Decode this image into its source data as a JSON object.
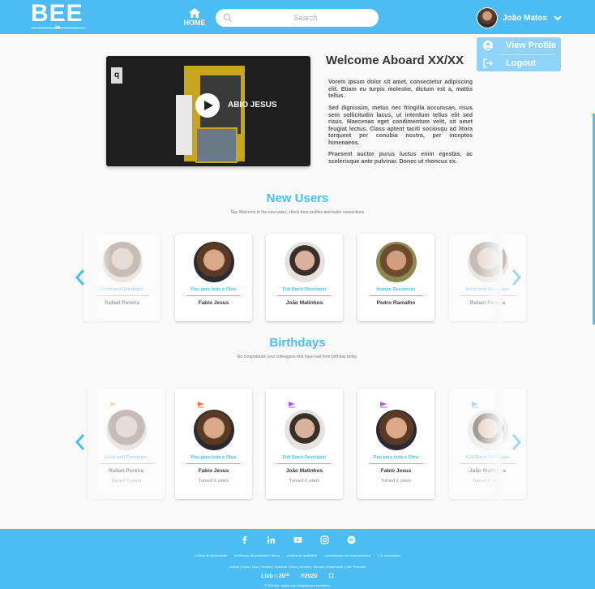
{
  "header": {
    "logo": "BEE",
    "logo_sub": "in",
    "home_label": "HOME",
    "search_placeholder": "Search",
    "user_name": "João Matos"
  },
  "dropdown": {
    "view_profile": "View Profile",
    "logout": "Logout"
  },
  "welcome": {
    "title": "Welcome Aboard XX/XX",
    "video_title": "ABIO JESUS",
    "video_badge": "q",
    "paragraphs": [
      "Vorem ipsum dolor sit amet, consectetur adipiscing elit. Etiam eu turpis molestie, dictum est a, mattis tellus.",
      "Sed dignissim, metus nec fringilla accumsan, risus sem sollicitudin lacus, ut interdum tellus elit sed risus. Maecenas eget condimentum velit, sit amet feugiat lectus. Class aptent taciti sociosqu ad litora torquent per conubia nostra, per inceptos himenaeos.",
      "Praesent auctor purus luctus enim egestas, ac scelerisque ante pulvinar. Donec ut rhoncus ex."
    ]
  },
  "new_users": {
    "title": "New Users",
    "subtitle": "Say Welcome to the new users, check their profiles and make connections",
    "cards": [
      {
        "role": "Front end Developer",
        "name": "Rafael Pereira"
      },
      {
        "role": "Pau para toda a Obra",
        "name": "Fabio Jesus"
      },
      {
        "role": "Full Stack Developer",
        "name": "João Matinhos"
      },
      {
        "role": "Human Resources",
        "name": "Pedro Ramalho"
      },
      {
        "role": "Front end Developer",
        "name": "Rafael Pereira"
      }
    ]
  },
  "birthdays": {
    "title": "Birthdays",
    "subtitle": "Go congratulate your colleagues that have had their birthday today.",
    "cards": [
      {
        "role": "Front end Developer",
        "name": "Rafael Pereira",
        "turned": "Turned X years"
      },
      {
        "role": "Pau para toda a Obra",
        "name": "Fabio Jesus",
        "turned": "Turned X years"
      },
      {
        "role": "Full Stack Developer",
        "name": "João Matinhos",
        "turned": "Turned X years"
      },
      {
        "role": "Pau para toda a Obra",
        "name": "Fabio Jesus",
        "turned": "Turned X years"
      },
      {
        "role": "Full Stack Developer",
        "name": "João Matinhos",
        "turned": "Turned X years"
      }
    ]
  },
  "footer": {
    "links": [
      "política de privacidade",
      "certificado de qualidade | lisboa",
      "política de qualidade",
      "comunicação de irregularidades",
      "L.A. consortium"
    ],
    "cities": "Lisboa | Porto | Lyon | Nantes | Toulouse | Paris | Amiens | Rennes | Mouthouse | Lille Prevision",
    "logos": [
      "Lisb☺20²⁰",
      "℗2020",
      "☐"
    ],
    "copyright": "© 2019 bee. origem com | Insignificance Innovations"
  },
  "colors": {
    "accent": "#4bbdf3",
    "dropdown": "#8fd4f8"
  }
}
